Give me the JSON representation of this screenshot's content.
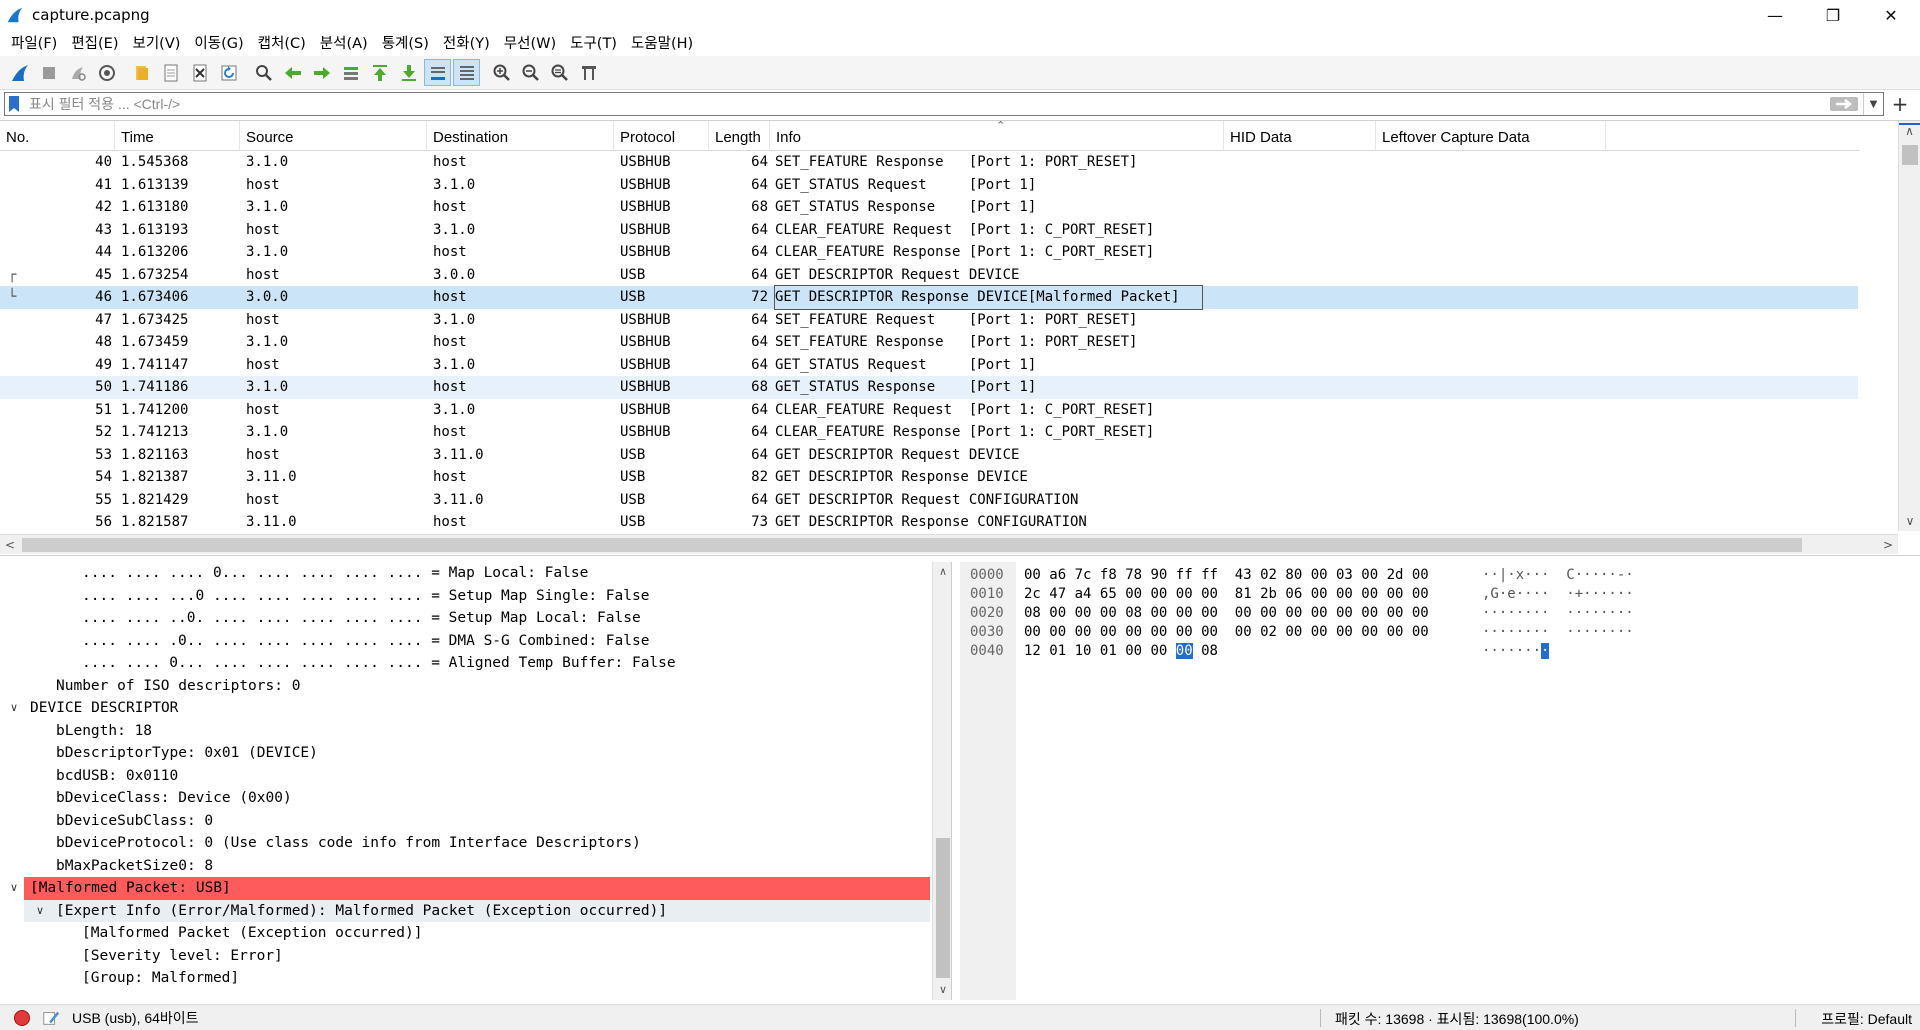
{
  "window": {
    "title": "capture.pcapng",
    "minimize": "—",
    "maximize": "❐",
    "close": "✕"
  },
  "menu": [
    "파일(F)",
    "편집(E)",
    "보기(V)",
    "이동(G)",
    "캡처(C)",
    "분석(A)",
    "통계(S)",
    "전화(Y)",
    "무선(W)",
    "도구(T)",
    "도움말(H)"
  ],
  "toolbar": {
    "icons": [
      "shark-fin-icon",
      "stop-icon",
      "restart-icon",
      "options-icon",
      "open-folder-icon",
      "file-icon",
      "close-file-icon",
      "reload-icon",
      "find-icon",
      "back-icon",
      "forward-icon",
      "goto-icon",
      "first-icon",
      "last-icon",
      "autoscroll-icon",
      "colorize-icon",
      "zoom-in-icon",
      "zoom-out-icon",
      "normal-size-icon",
      "resize-columns-icon"
    ]
  },
  "filter": {
    "placeholder": "표시 필터 적용 ... <Ctrl-/>",
    "value": ""
  },
  "packet_list": {
    "columns": [
      "No.",
      "Time",
      "Source",
      "Destination",
      "Protocol",
      "Length",
      "Info",
      "HID Data",
      "Leftover Capture Data"
    ],
    "rows": [
      {
        "no": "40",
        "time": "1.545368",
        "src": "3.1.0",
        "dst": "host",
        "proto": "USBHUB",
        "len": "64",
        "info": "SET_FEATURE Response   [Port 1: PORT_RESET]"
      },
      {
        "no": "41",
        "time": "1.613139",
        "src": "host",
        "dst": "3.1.0",
        "proto": "USBHUB",
        "len": "64",
        "info": "GET_STATUS Request     [Port 1]"
      },
      {
        "no": "42",
        "time": "1.613180",
        "src": "3.1.0",
        "dst": "host",
        "proto": "USBHUB",
        "len": "68",
        "info": "GET_STATUS Response    [Port 1]"
      },
      {
        "no": "43",
        "time": "1.613193",
        "src": "host",
        "dst": "3.1.0",
        "proto": "USBHUB",
        "len": "64",
        "info": "CLEAR_FEATURE Request  [Port 1: C_PORT_RESET]"
      },
      {
        "no": "44",
        "time": "1.613206",
        "src": "3.1.0",
        "dst": "host",
        "proto": "USBHUB",
        "len": "64",
        "info": "CLEAR_FEATURE Response [Port 1: C_PORT_RESET]"
      },
      {
        "no": "45",
        "time": "1.673254",
        "src": "host",
        "dst": "3.0.0",
        "proto": "USB",
        "len": "64",
        "info": "GET DESCRIPTOR Request DEVICE"
      },
      {
        "no": "46",
        "time": "1.673406",
        "src": "3.0.0",
        "dst": "host",
        "proto": "USB",
        "len": "72",
        "info": "GET DESCRIPTOR Response DEVICE[Malformed Packet]"
      },
      {
        "no": "47",
        "time": "1.673425",
        "src": "host",
        "dst": "3.1.0",
        "proto": "USBHUB",
        "len": "64",
        "info": "SET_FEATURE Request    [Port 1: PORT_RESET]"
      },
      {
        "no": "48",
        "time": "1.673459",
        "src": "3.1.0",
        "dst": "host",
        "proto": "USBHUB",
        "len": "64",
        "info": "SET_FEATURE Response   [Port 1: PORT_RESET]"
      },
      {
        "no": "49",
        "time": "1.741147",
        "src": "host",
        "dst": "3.1.0",
        "proto": "USBHUB",
        "len": "64",
        "info": "GET_STATUS Request     [Port 1]"
      },
      {
        "no": "50",
        "time": "1.741186",
        "src": "3.1.0",
        "dst": "host",
        "proto": "USBHUB",
        "len": "68",
        "info": "GET_STATUS Response    [Port 1]"
      },
      {
        "no": "51",
        "time": "1.741200",
        "src": "host",
        "dst": "3.1.0",
        "proto": "USBHUB",
        "len": "64",
        "info": "CLEAR_FEATURE Request  [Port 1: C_PORT_RESET]"
      },
      {
        "no": "52",
        "time": "1.741213",
        "src": "3.1.0",
        "dst": "host",
        "proto": "USBHUB",
        "len": "64",
        "info": "CLEAR_FEATURE Response [Port 1: C_PORT_RESET]"
      },
      {
        "no": "53",
        "time": "1.821163",
        "src": "host",
        "dst": "3.11.0",
        "proto": "USB",
        "len": "64",
        "info": "GET DESCRIPTOR Request DEVICE"
      },
      {
        "no": "54",
        "time": "1.821387",
        "src": "3.11.0",
        "dst": "host",
        "proto": "USB",
        "len": "82",
        "info": "GET DESCRIPTOR Response DEVICE"
      },
      {
        "no": "55",
        "time": "1.821429",
        "src": "host",
        "dst": "3.11.0",
        "proto": "USB",
        "len": "64",
        "info": "GET DESCRIPTOR Request CONFIGURATION"
      },
      {
        "no": "56",
        "time": "1.821587",
        "src": "3.11.0",
        "dst": "host",
        "proto": "USB",
        "len": "73",
        "info": "GET DESCRIPTOR Response CONFIGURATION"
      }
    ],
    "selected_no": "46",
    "highlight_no": "50"
  },
  "details": {
    "rows": [
      {
        "text": ".... .... .... 0... .... .... .... .... = Map Local: False",
        "indent": 3,
        "toggle": ""
      },
      {
        "text": ".... .... ...0 .... .... .... .... .... = Setup Map Single: False",
        "indent": 3,
        "toggle": ""
      },
      {
        "text": ".... .... ..0. .... .... .... .... .... = Setup Map Local: False",
        "indent": 3,
        "toggle": ""
      },
      {
        "text": ".... .... .0.. .... .... .... .... .... = DMA S-G Combined: False",
        "indent": 3,
        "toggle": ""
      },
      {
        "text": ".... .... 0... .... .... .... .... .... = Aligned Temp Buffer: False",
        "indent": 3,
        "toggle": ""
      },
      {
        "text": "Number of ISO descriptors: 0",
        "indent": 2,
        "toggle": ""
      },
      {
        "text": "DEVICE DESCRIPTOR",
        "indent": 1,
        "toggle": "v"
      },
      {
        "text": "bLength: 18",
        "indent": 2,
        "toggle": ""
      },
      {
        "text": "bDescriptorType: 0x01 (DEVICE)",
        "indent": 2,
        "toggle": ""
      },
      {
        "text": "bcdUSB: 0x0110",
        "indent": 2,
        "toggle": ""
      },
      {
        "text": "bDeviceClass: Device (0x00)",
        "indent": 2,
        "toggle": ""
      },
      {
        "text": "bDeviceSubClass: 0",
        "indent": 2,
        "toggle": ""
      },
      {
        "text": "bDeviceProtocol: 0 (Use class code info from Interface Descriptors)",
        "indent": 2,
        "toggle": ""
      },
      {
        "text": "bMaxPacketSize0: 8",
        "indent": 2,
        "toggle": ""
      },
      {
        "text": "[Malformed Packet: USB]",
        "indent": 1,
        "toggle": "v",
        "style": "err"
      },
      {
        "text": "[Expert Info (Error/Malformed): Malformed Packet (Exception occurred)]",
        "indent": 2,
        "toggle": "v",
        "style": "hl"
      },
      {
        "text": "[Malformed Packet (Exception occurred)]",
        "indent": 3,
        "toggle": ""
      },
      {
        "text": "[Severity level: Error]",
        "indent": 3,
        "toggle": ""
      },
      {
        "text": "[Group: Malformed]",
        "indent": 3,
        "toggle": ""
      }
    ]
  },
  "bytes": {
    "rows": [
      {
        "offset": "0000",
        "hex": [
          "00",
          "a6",
          "7c",
          "f8",
          "78",
          "90",
          "ff",
          "ff",
          "43",
          "02",
          "80",
          "00",
          "03",
          "00",
          "2d",
          "00"
        ],
        "ascii": "··|·x···  C·····-·"
      },
      {
        "offset": "0010",
        "hex": [
          "2c",
          "47",
          "a4",
          "65",
          "00",
          "00",
          "00",
          "00",
          "81",
          "2b",
          "06",
          "00",
          "00",
          "00",
          "00",
          "00"
        ],
        "ascii": ",G·e····  ·+······"
      },
      {
        "offset": "0020",
        "hex": [
          "08",
          "00",
          "00",
          "00",
          "08",
          "00",
          "00",
          "00",
          "00",
          "00",
          "00",
          "00",
          "00",
          "00",
          "00",
          "00"
        ],
        "ascii": "········  ········"
      },
      {
        "offset": "0030",
        "hex": [
          "00",
          "00",
          "00",
          "00",
          "00",
          "00",
          "00",
          "00",
          "00",
          "02",
          "00",
          "00",
          "00",
          "00",
          "00",
          "00"
        ],
        "ascii": "········  ········"
      },
      {
        "offset": "0040",
        "hex": [
          "12",
          "01",
          "10",
          "01",
          "00",
          "00",
          "00",
          "08"
        ],
        "ascii": "·······",
        "selected_index": 6,
        "ascii_selected": "·"
      }
    ]
  },
  "status": {
    "left": "USB (usb), 64바이트",
    "counts": "패킷 수: 13698 · 표시됨: 13698(100.0%)",
    "profile": "프로필: Default"
  },
  "colors": {
    "selected_row": "#cce4f7",
    "alt_row": "#e6f1fb",
    "error_row": "#fe5c5c",
    "accent": "#1e6fcf"
  }
}
